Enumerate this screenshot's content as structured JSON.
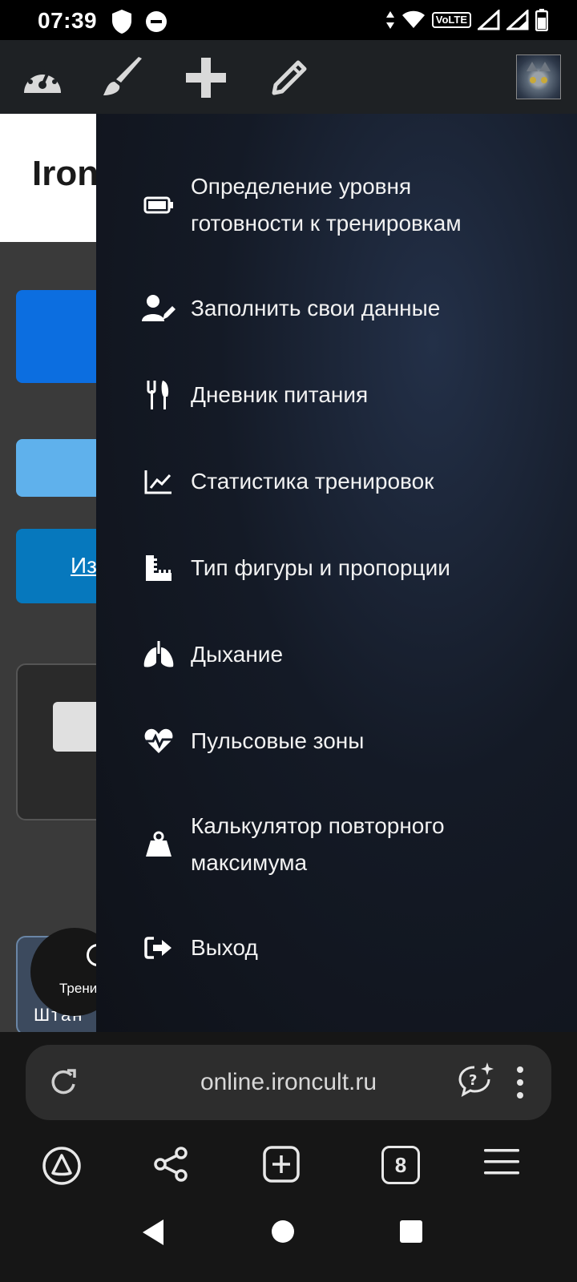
{
  "status_bar": {
    "time": "07:39",
    "network": "VoLTE",
    "icons": [
      "shield-icon",
      "do-not-disturb-icon",
      "data-arrows-icon",
      "wifi-icon",
      "signal-icon",
      "signal-icon",
      "battery-icon"
    ]
  },
  "toolbar": {
    "icons": [
      "dashboard-icon",
      "brush-icon",
      "plus-icon",
      "pencil-icon"
    ],
    "avatar": "user-avatar"
  },
  "page": {
    "title_partial": "Iron",
    "link_partial": "Из",
    "card_text_partial": "Штан",
    "fab_label_partial": "Трени"
  },
  "drawer": {
    "items": [
      {
        "label": "Определение уровня готовности к тренировкам",
        "icon": "battery-icon"
      },
      {
        "label": "Заполнить свои данные",
        "icon": "user-edit-icon"
      },
      {
        "label": "Дневник питания",
        "icon": "utensils-icon"
      },
      {
        "label": "Статистика тренировок",
        "icon": "chart-line-icon"
      },
      {
        "label": "Тип фигуры и пропорции",
        "icon": "ruler-icon"
      },
      {
        "label": "Дыхание",
        "icon": "lungs-icon"
      },
      {
        "label": "Пульсовые зоны",
        "icon": "heart-pulse-icon"
      },
      {
        "label": "Калькулятор повторного максимума",
        "icon": "weight-icon"
      },
      {
        "label": "Выход",
        "icon": "logout-icon"
      }
    ]
  },
  "browser": {
    "url": "online.ironcult.ru",
    "tab_count": "8",
    "nav_icons": [
      "alice-icon",
      "share-icon",
      "new-tab-icon",
      "tabs-icon",
      "menu-icon"
    ]
  },
  "colors": {
    "drawer_bg": "#141a26",
    "blue1": "#0c6ee0",
    "blue2": "#5fb1ec",
    "blue3": "#0678bd"
  }
}
